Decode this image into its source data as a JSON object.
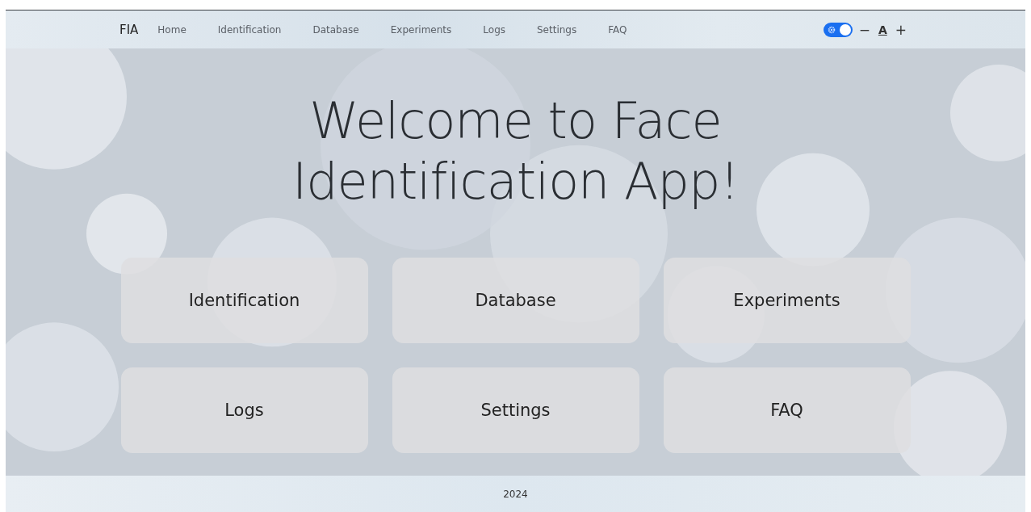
{
  "navbar": {
    "brand": "FIA",
    "items": [
      "Home",
      "Identification",
      "Database",
      "Experiments",
      "Logs",
      "Settings",
      "FAQ"
    ],
    "theme_toggle": {
      "on": true
    },
    "font_controls": {
      "decrease": "−",
      "reset": "A",
      "increase": "+"
    }
  },
  "hero": {
    "title": "Welcome to Face Identification App!",
    "tiles": [
      "Identification",
      "Database",
      "Experiments",
      "Logs",
      "Settings",
      "FAQ"
    ]
  },
  "footer": {
    "text": "2024"
  }
}
